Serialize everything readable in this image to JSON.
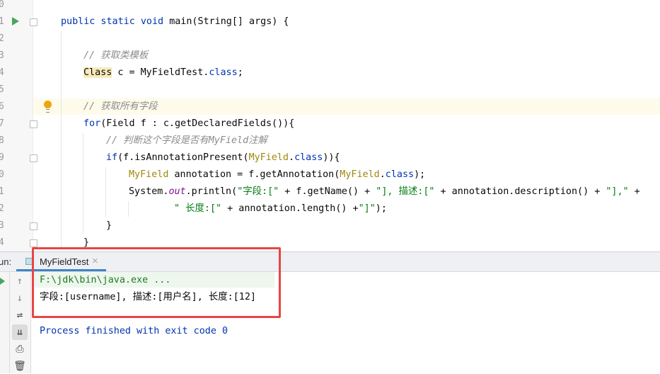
{
  "editor": {
    "line_numbers": [
      "0",
      "1",
      "2",
      "3",
      "4",
      "5",
      "6",
      "7",
      "8",
      "9",
      "0",
      "1",
      "2",
      "3",
      "4"
    ],
    "lines": [
      {
        "indent": 0,
        "tokens": []
      },
      {
        "indent": 0,
        "tokens": [
          {
            "t": "public static void ",
            "c": "kw"
          },
          {
            "t": "main(String[] args) {",
            "c": ""
          }
        ]
      },
      {
        "indent": 0,
        "tokens": []
      },
      {
        "indent": 1,
        "tokens": [
          {
            "t": "// 获取类模板",
            "c": "cm"
          }
        ]
      },
      {
        "indent": 1,
        "tokens": [
          {
            "t": "Class",
            "c": "clshl"
          },
          {
            "t": " c = MyFieldTest.",
            "c": ""
          },
          {
            "t": "class",
            "c": "kw"
          },
          {
            "t": ";",
            "c": ""
          }
        ]
      },
      {
        "indent": 0,
        "tokens": []
      },
      {
        "indent": 1,
        "tokens": [
          {
            "t": "// 获取所有字段",
            "c": "cm"
          }
        ]
      },
      {
        "indent": 1,
        "tokens": [
          {
            "t": "for",
            "c": "kw"
          },
          {
            "t": "(Field f : c.getDeclaredFields()){",
            "c": ""
          }
        ]
      },
      {
        "indent": 2,
        "tokens": [
          {
            "t": "// 判断这个字段是否有MyField注解",
            "c": "cm"
          }
        ]
      },
      {
        "indent": 2,
        "tokens": [
          {
            "t": "if",
            "c": "kw"
          },
          {
            "t": "(f.isAnnotationPresent(",
            "c": ""
          },
          {
            "t": "MyField",
            "c": "cls"
          },
          {
            "t": ".",
            "c": ""
          },
          {
            "t": "class",
            "c": "kw"
          },
          {
            "t": ")){",
            "c": ""
          }
        ]
      },
      {
        "indent": 3,
        "tokens": [
          {
            "t": "MyField",
            "c": "cls"
          },
          {
            "t": " annotation = f.getAnnotation(",
            "c": ""
          },
          {
            "t": "MyField",
            "c": "cls"
          },
          {
            "t": ".",
            "c": ""
          },
          {
            "t": "class",
            "c": "kw"
          },
          {
            "t": ");",
            "c": ""
          }
        ]
      },
      {
        "indent": 3,
        "tokens": [
          {
            "t": "System.",
            "c": ""
          },
          {
            "t": "out",
            "c": "fld"
          },
          {
            "t": ".println(",
            "c": ""
          },
          {
            "t": "\"字段:[\"",
            "c": "str"
          },
          {
            "t": " + f.getName() + ",
            "c": ""
          },
          {
            "t": "\"], 描述:[\"",
            "c": "str"
          },
          {
            "t": " + annotation.description() + ",
            "c": ""
          },
          {
            "t": "\"],\"",
            "c": "str"
          },
          {
            "t": " +",
            "c": ""
          }
        ]
      },
      {
        "indent": 5,
        "tokens": [
          {
            "t": "\" 长度:[\"",
            "c": "str"
          },
          {
            "t": " + annotation.length() +",
            "c": ""
          },
          {
            "t": "\"]\"",
            "c": "str"
          },
          {
            "t": ");",
            "c": ""
          }
        ]
      },
      {
        "indent": 2,
        "tokens": [
          {
            "t": "}",
            "c": ""
          }
        ]
      },
      {
        "indent": 1,
        "tokens": [
          {
            "t": "}",
            "c": ""
          }
        ]
      }
    ]
  },
  "run": {
    "label": "un:",
    "tab_label": "MyFieldTest",
    "close": "×",
    "console": [
      {
        "text": "F:\\jdk\\bin\\java.exe ...",
        "color": "#1f7a1f"
      },
      {
        "text": "字段:[username], 描述:[用户名], 长度:[12]",
        "color": "#080808"
      },
      {
        "text": "",
        "color": "#080808"
      },
      {
        "text": "Process finished with exit code 0",
        "color": "#0033b3"
      }
    ]
  }
}
